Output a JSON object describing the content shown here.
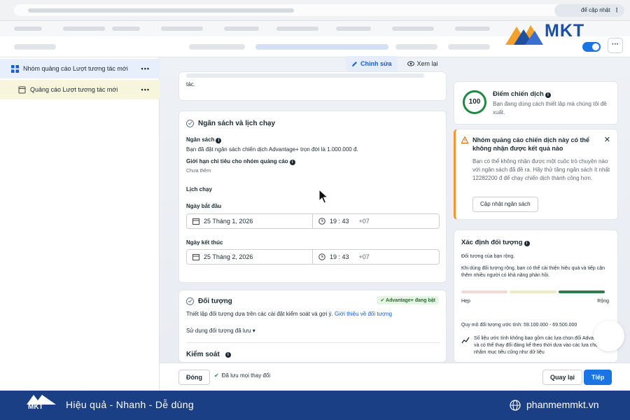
{
  "browser": {
    "update_button": "để cập nhật"
  },
  "brand": {
    "logo_text": "MKT",
    "logo_small": "MKT",
    "slogan": "Hiệu quả - Nhanh - Dễ dùng",
    "site": "phanmemmkt.vn"
  },
  "sidebar": {
    "items": [
      {
        "label": "Nhóm quảng cáo Lượt tương tác mới",
        "icon": "grid-icon"
      },
      {
        "label": "Quảng cáo Lượt tương tác mới",
        "icon": "ad-page-icon"
      }
    ]
  },
  "toolbar": {
    "edit_label": "Chỉnh sửa",
    "review_label": "Xem lại"
  },
  "top_card": {
    "text": "tác."
  },
  "budget": {
    "section_title": "Ngân sách và lịch chạy",
    "budget_label": "Ngân sách",
    "budget_desc": "Bạn đã đặt ngân sách chiến dịch Advantage+ trọn đời là 1.000.000 đ.",
    "limit_label": "Giới hạn chi tiêu cho nhóm quảng cáo",
    "limit_value": "Chưa thêm",
    "schedule_label": "Lịch chạy",
    "start_label": "Ngày bắt đầu",
    "start_date": "25 Tháng 1, 2026",
    "start_time": "19 : 43",
    "start_tz": "+07",
    "end_label": "Ngày kết thúc",
    "end_date": "25 Tháng 2, 2026",
    "end_time": "19 : 43",
    "end_tz": "+07"
  },
  "audience": {
    "section_title": "Đối tượng",
    "badge": "Advantage+ đang bật",
    "desc": "Thiết lập đối tượng dựa trên các cài đặt kiểm soát và gợi ý.",
    "desc_link": "Giới thiệu về đối tượng",
    "saved_audience": "Sử dụng đối tượng đã lưu",
    "control_label": "Kiểm soát"
  },
  "score": {
    "value": "100",
    "title": "Điểm chiến dịch",
    "desc": "Bạn đang dùng cách thiết lập mà chúng tôi đề xuất."
  },
  "warning": {
    "title": "Nhóm quảng cáo chiến dịch này có thể không nhận được kết quả nào",
    "desc": "Bạn có thể không nhận được một cuộc trò chuyện nào với ngân sách đã đề ra. Hãy thử tăng ngân sách ít nhất 12282200 đ để chạy chiến dịch thành công hơn.",
    "button": "Cập nhật ngân sách"
  },
  "target": {
    "title": "Xác định đối tượng",
    "status": "Đối tượng của bạn rộng.",
    "desc": "Khi dùng đối tượng rộng, bạn có thể cải thiện hiệu quả và tiếp cận thêm nhiều người có khả năng phản hồi.",
    "narrow": "Hẹp",
    "wide": "Rộng",
    "size": "Quy mô đối tượng ước tính: 59.100.000 - 69.500.000",
    "note": "Số liệu ước tính không bao gồm các lựa chọn đối Advantage+ và có thể thay đổi đáng kể theo thời dựa vào các lựa chọn nhắm mục tiêu cũng như dữ liệu"
  },
  "footer": {
    "close": "Đóng",
    "saved": "Đã lưu mọi thay đổi",
    "back": "Quay lại",
    "next": "Tiếp"
  },
  "colors": {
    "primary": "#1a74e4",
    "brand_bar": "#1b3f84",
    "warning": "#f0962d",
    "success": "#1d8a43"
  },
  "gauge": {
    "filled_segment": 3,
    "segments": 3
  }
}
